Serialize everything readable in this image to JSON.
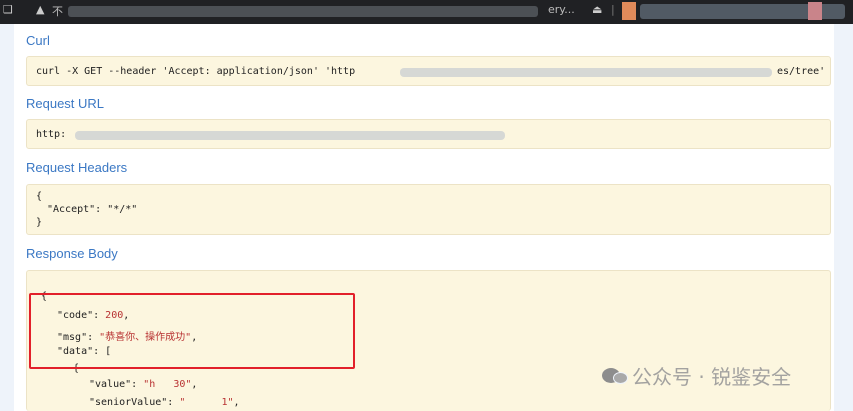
{
  "browser_bar": {
    "bookmark_glyph": "❑",
    "warning_glyph": "▲",
    "partial_text": "不",
    "gallery_text": "ery...",
    "share_glyph": "⏏",
    "divider_glyph": "|"
  },
  "curl": {
    "title": "Curl",
    "command_start": "curl -X GET --header 'Accept: application/json' 'http",
    "command_end": "es/tree'"
  },
  "request_url": {
    "title": "Request URL",
    "value_start": "http:"
  },
  "request_headers": {
    "title": "Request Headers",
    "open_brace": "{",
    "accept_key": "\"Accept\"",
    "colon": ": ",
    "accept_value": "\"*/*\"",
    "close_brace": "}"
  },
  "response_body": {
    "title": "Response Body",
    "open_brace": "{",
    "code_key": "\"code\"",
    "code_value": "200",
    "msg_key": "\"msg\"",
    "msg_value": "\"恭喜你、操作成功\"",
    "data_key": "\"data\"",
    "data_open": "[",
    "item_open": "{",
    "value_key": "\"value\"",
    "value_start": "\"h",
    "value_end": "30\"",
    "senior_key": "\"seniorValue\"",
    "senior_start": "\"",
    "senior_end": "1\""
  },
  "watermark": {
    "text": "公众号 · 锐鉴安全"
  },
  "colors": {
    "accent_blue": "#3b78c4",
    "code_background": "#fcf6df",
    "highlight_red": "#e2202a",
    "json_string_red": "#b83232"
  }
}
